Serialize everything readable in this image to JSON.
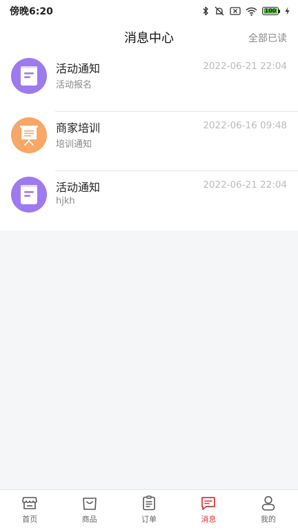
{
  "status_bar": {
    "time": "傍晚6:20",
    "battery": "100"
  },
  "header": {
    "title": "消息中心",
    "mark_all_read": "全部已读"
  },
  "messages": [
    {
      "title": "活动通知",
      "subtitle": "活动报名",
      "time": "2022-06-21 22:04",
      "icon": "notebook-icon",
      "color": "#9d7aef"
    },
    {
      "title": "商家培训",
      "subtitle": "培训通知",
      "time": "2022-06-16 09:48",
      "icon": "presentation-board-icon",
      "color": "#f8a766"
    },
    {
      "title": "活动通知",
      "subtitle": "hjkh",
      "time": "2022-06-21 22:04",
      "icon": "notebook-icon",
      "color": "#9d7aef"
    }
  ],
  "tabbar": {
    "tabs": [
      {
        "label": "首页",
        "icon": "store-icon"
      },
      {
        "label": "商品",
        "icon": "shopping-bag-icon"
      },
      {
        "label": "订单",
        "icon": "clipboard-icon"
      },
      {
        "label": "消息",
        "icon": "chat-message-icon",
        "active": true
      },
      {
        "label": "我的",
        "icon": "user-icon"
      }
    ],
    "active_color": "#e02f2f",
    "inactive_color": "#666666"
  }
}
